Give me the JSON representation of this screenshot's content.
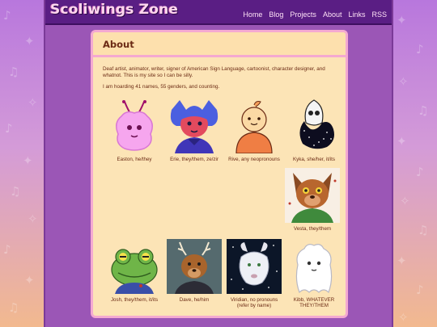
{
  "site": {
    "logo": "Scoliwings Zone"
  },
  "nav": [
    "Home",
    "Blog",
    "Projects",
    "About",
    "Links",
    "RSS"
  ],
  "page": {
    "title": "About",
    "intro": "Deaf artist, animator, writer, signer of American Sign Language, cartoonist, character designer, and whatnot. This is my site so I can be silly.",
    "names_note": "I am hoarding 41 names, 55 genders, and counting."
  },
  "gallery": [
    {
      "caption": "Easton, he/they",
      "icon": "pink-moth-icon"
    },
    {
      "caption": "Erie, they/them, ze/zir",
      "icon": "blue-haired-character-icon"
    },
    {
      "caption": "Rive, any neopronouns",
      "icon": "orange-blob-character-icon"
    },
    {
      "caption": "Kyka, she/her, it/its",
      "icon": "skull-starry-creature-icon"
    },
    {
      "caption": "Vesta, they/them",
      "icon": "brown-dog-character-icon"
    },
    {
      "caption": "Josh, they/them, it/its",
      "icon": "green-frog-icon"
    },
    {
      "caption": "Dave, he/him",
      "icon": "antlered-deer-icon"
    },
    {
      "caption": "Viridian, no pronouns (refer by name)",
      "icon": "white-goat-icon"
    },
    {
      "caption": "Kibb, WHATEVER THEY/THEM",
      "icon": "white-ghost-icon"
    }
  ],
  "colors": {
    "topbar": "#5a1e84",
    "column": "#9b56b6",
    "card": "#fce4b6",
    "card_border": "#f4a9d1",
    "text": "#6b2a14"
  }
}
